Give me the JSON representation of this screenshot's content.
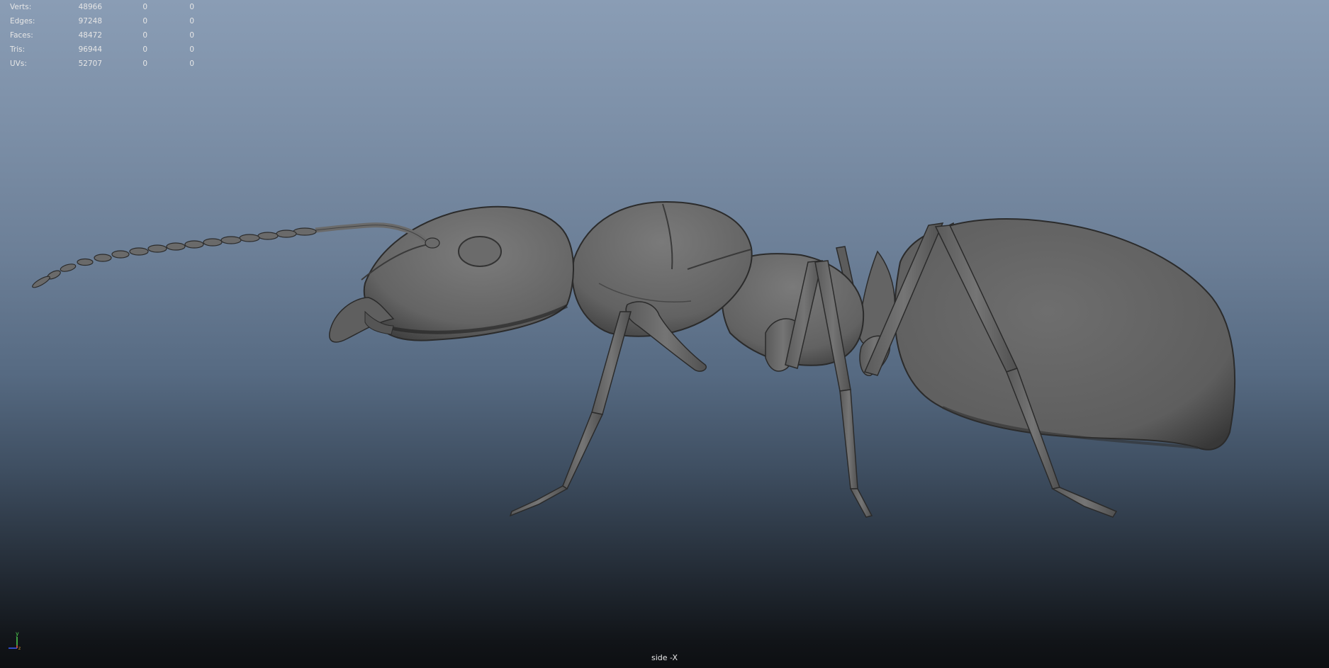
{
  "hud": {
    "rows": [
      {
        "label": "Verts:",
        "total": "48966",
        "selected": "0",
        "highlighted": "0"
      },
      {
        "label": "Edges:",
        "total": "97248",
        "selected": "0",
        "highlighted": "0"
      },
      {
        "label": "Faces:",
        "total": "48472",
        "selected": "0",
        "highlighted": "0"
      },
      {
        "label": "Tris:",
        "total": "96944",
        "selected": "0",
        "highlighted": "0"
      },
      {
        "label": "UVs:",
        "total": "52707",
        "selected": "0",
        "highlighted": "0"
      }
    ]
  },
  "axis": {
    "y_label": "y",
    "z_label": "z"
  },
  "camera": {
    "label": "side -X"
  },
  "colors": {
    "viewport_top": "#8a9db5",
    "viewport_bottom": "#0d0f12",
    "model_fill": "#6a6a6a",
    "model_shadow": "#3a3a3a",
    "model_edge": "#2b2b2b",
    "hud_text": "#e6e6e6",
    "axis_y": "#4fcf4f",
    "axis_z": "#3a5cff",
    "axis_x": "#e04040"
  },
  "icons": {
    "axis_gizmo": "axis-gizmo-icon",
    "model": "ant-mesh"
  }
}
